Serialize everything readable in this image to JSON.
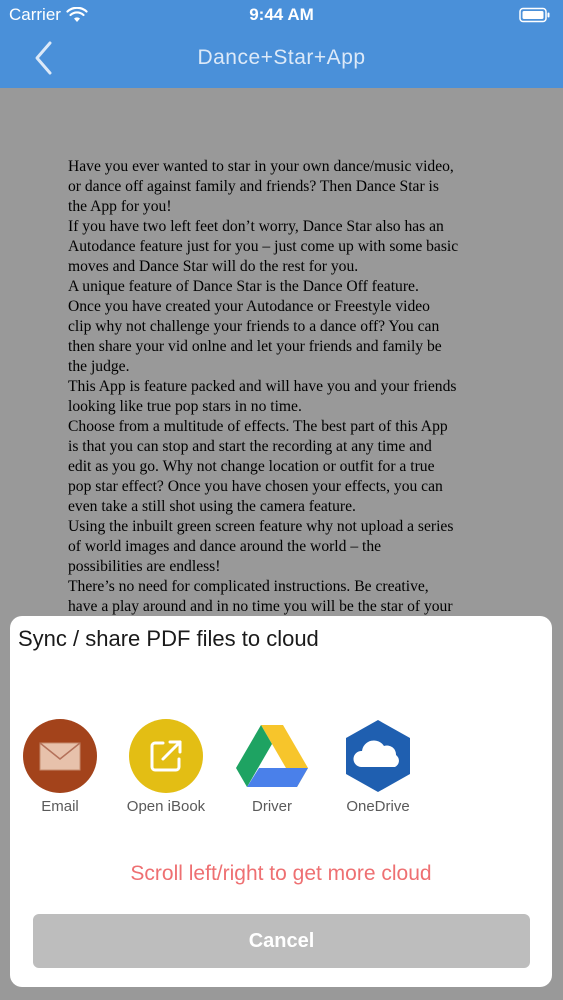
{
  "status_bar": {
    "carrier": "Carrier",
    "time": "9:44 AM"
  },
  "nav": {
    "title": "Dance+Star+App",
    "back_icon": "chevron-left-icon",
    "color": "#4a90d9"
  },
  "document": {
    "lines": [
      "Have you ever wanted to star in your own dance/music video,",
      "or dance off against family and friends?  Then Dance Star is",
      "the App for you!",
      "If you have two left feet don’t worry, Dance Star also has an",
      "Autodance feature just for you – just come up with some basic",
      "moves and Dance Star will do the rest for you.",
      "A unique feature of Dance Star is the Dance Off feature.",
      " Once you have created your Autodance or Freestyle video",
      "clip why not challenge your friends to a dance off?   You can",
      "then share your vid onlne and let your friends and family be",
      "the judge.",
      "This App is feature packed and will have you and your friends",
      "looking like true pop stars in no time.",
      "Choose from a multitude of effects.  The best part of this App",
      "is that you can stop and start the recording at any time and",
      "edit as you go.  Why not change location or outfit for a true",
      "pop star effect?  Once you have chosen your effects, you can",
      "even take a still shot using the camera feature.",
      "Using the inbuilt green screen feature why not upload a series",
      "of world images and dance around the world – the",
      "possibilities are endless!",
      "There’s no need for complicated instructions.  Be creative,",
      "have a play around and in no time you will be the star of your"
    ]
  },
  "sheet": {
    "title": "Sync / share PDF files to cloud",
    "clouds": [
      {
        "label": "Email",
        "icon": "envelope-icon",
        "color": "#a3431b"
      },
      {
        "label": "Open iBook",
        "icon": "open-external-icon",
        "color": "#e3be14"
      },
      {
        "label": "Driver",
        "icon": "google-drive-icon",
        "color": "#1ea362"
      },
      {
        "label": "OneDrive",
        "icon": "onedrive-cloud-icon",
        "color": "#1f5fb0"
      }
    ],
    "hint": "Scroll left/right to get more cloud",
    "cancel_label": "Cancel"
  }
}
